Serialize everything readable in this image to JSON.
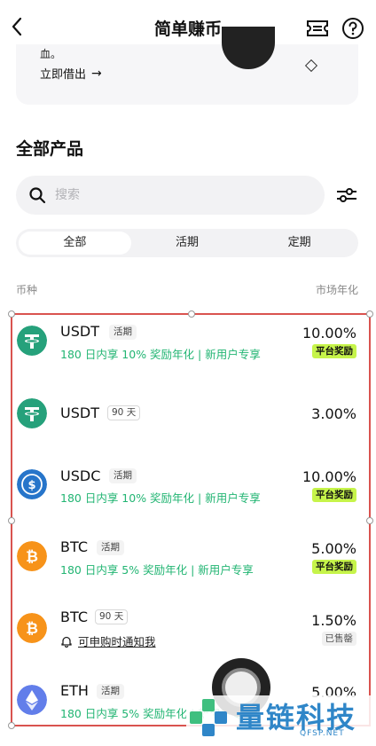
{
  "header": {
    "title": "简单赚币"
  },
  "top_card": {
    "fragment_text": "血。",
    "borrow_label": "立即借出",
    "borrow_arrow": "→"
  },
  "section_title": "全部产品",
  "search": {
    "placeholder": "搜索"
  },
  "tabs": [
    {
      "label": "全部",
      "active": true
    },
    {
      "label": "活期",
      "active": false
    },
    {
      "label": "定期",
      "active": false
    }
  ],
  "columns": {
    "left": "币种",
    "right": "市场年化"
  },
  "products": [
    {
      "name": "USDT",
      "tag": "活期",
      "subtitle": "180 日内享 10% 奖励年化 | 新用户专享",
      "rate": "10.00%",
      "badge": "平台奖励",
      "coin_color": "#26a17b",
      "coin_icon": "tether-icon"
    },
    {
      "name": "USDT",
      "tag": "90 天",
      "subtitle": "",
      "rate": "3.00%",
      "badge": "",
      "coin_color": "#26a17b",
      "coin_icon": "tether-icon"
    },
    {
      "name": "USDC",
      "tag": "活期",
      "subtitle": "180 日内享 10% 奖励年化 | 新用户专享",
      "rate": "10.00%",
      "badge": "平台奖励",
      "coin_color": "#2775ca",
      "coin_icon": "usdc-icon"
    },
    {
      "name": "BTC",
      "tag": "活期",
      "subtitle": "180 日内享 5% 奖励年化 | 新用户专享",
      "rate": "5.00%",
      "badge": "平台奖励",
      "coin_color": "#f7931a",
      "coin_icon": "bitcoin-icon"
    },
    {
      "name": "BTC",
      "tag": "90 天",
      "notify": "可申购时通知我",
      "rate": "1.50%",
      "badge": "已售罄",
      "coin_color": "#f7931a",
      "coin_icon": "bitcoin-icon"
    },
    {
      "name": "ETH",
      "tag": "活期",
      "subtitle": "180 日内享 5% 奖励年化 | 新用户专享",
      "rate": "5.00%",
      "badge": "",
      "coin_color": "#627eea",
      "coin_icon": "ethereum-icon"
    }
  ],
  "watermark": {
    "text": "量链科技",
    "sub": "QFSP.NET"
  },
  "colors": {
    "accent_green": "#22b573",
    "badge_lime": "#c6f44a",
    "selection_red": "#d9534f",
    "watermark_blue": "#2f86c8"
  }
}
